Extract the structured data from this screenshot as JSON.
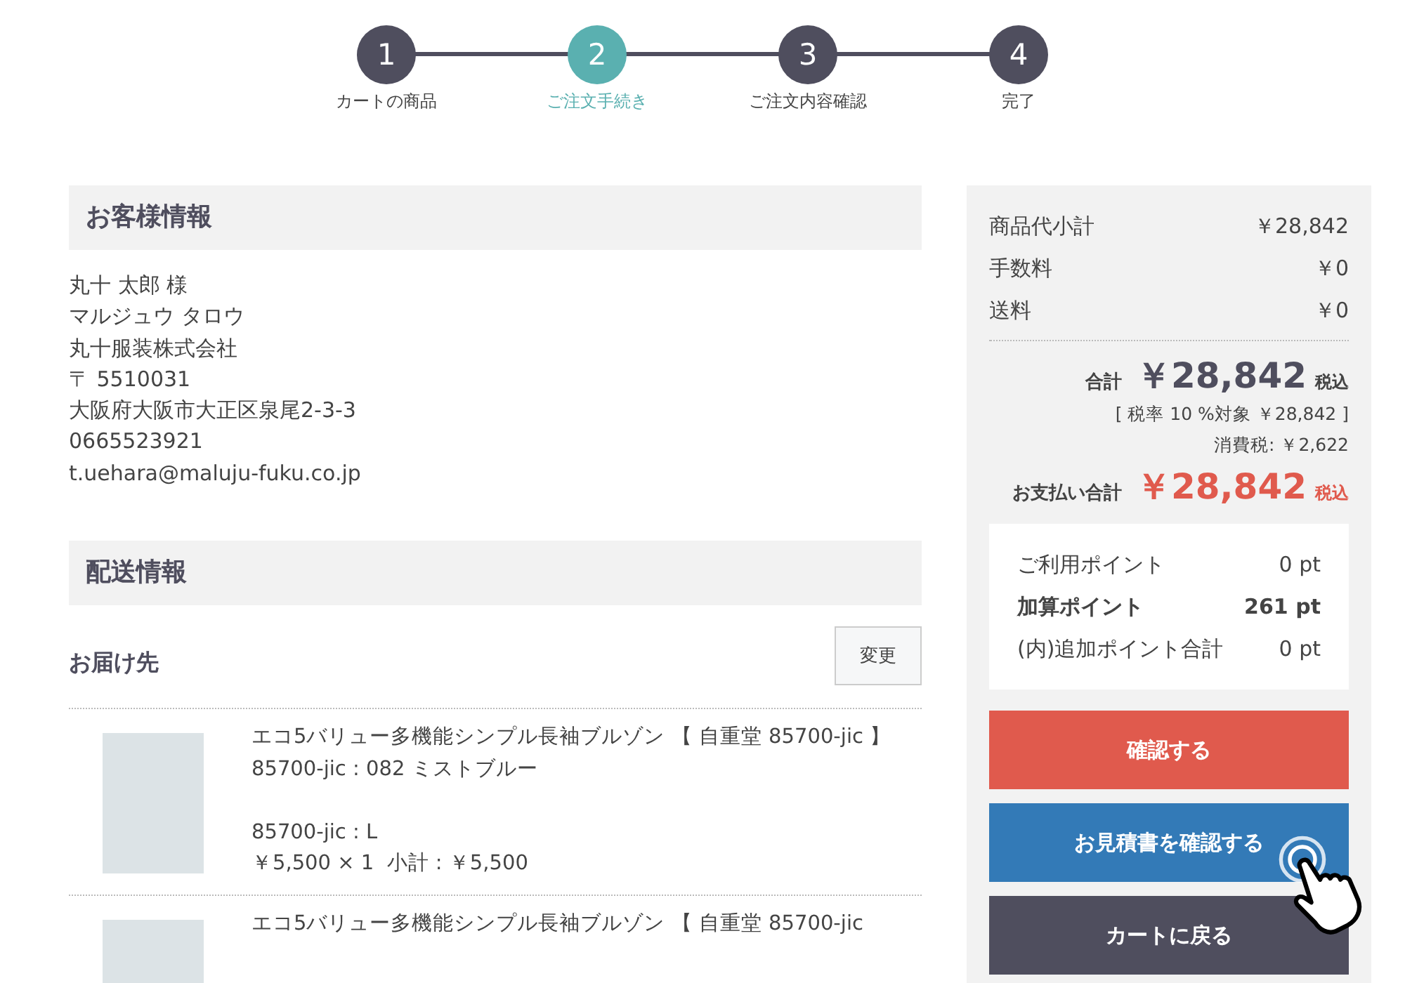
{
  "steps": [
    {
      "number": "1",
      "label": "カートの商品",
      "selected": false
    },
    {
      "number": "2",
      "label": "ご注文手続き",
      "selected": true
    },
    {
      "number": "3",
      "label": "ご注文内容確認",
      "selected": false
    },
    {
      "number": "4",
      "label": "完了",
      "selected": false
    }
  ],
  "customer": {
    "heading": "お客様情報",
    "lines": [
      "丸十 太郎 様",
      "マルジュウ タロウ",
      "丸十服装株式会社",
      "〒 5510031",
      "大阪府大阪市大正区泉尾2-3-3",
      "0665523921",
      "t.uehara@maluju-fuku.co.jp"
    ]
  },
  "shipping": {
    "heading": "配送情報",
    "destination_label": "お届け先",
    "change_button": "変更",
    "items": [
      {
        "title": "エコ5バリュー多機能シンプル長袖ブルゾン 【 自重堂 85700-jic 】",
        "option_line": "85700-jic : 082 ミストブルー",
        "size_line": "85700-jic : L",
        "price_line": "￥5,500 × 1  小計 : ￥5,500"
      },
      {
        "title": "エコ5バリュー多機能シンプル長袖ブルゾン 【 自重堂 85700-jic"
      }
    ]
  },
  "summary": {
    "rows": [
      {
        "label": "商品代小計",
        "value": "￥28,842"
      },
      {
        "label": "手数料",
        "value": "￥0"
      },
      {
        "label": "送料",
        "value": "￥0"
      }
    ],
    "total": {
      "label": "合計",
      "amount": "￥28,842",
      "tax_note": "税込"
    },
    "tax_rate_line": "[ 税率 10 %対象 ￥28,842 ]",
    "consumption_tax": "消費税: ￥2,622",
    "payment": {
      "label": "お支払い合計",
      "amount": "￥28,842",
      "tax_note": "税込"
    },
    "points": [
      {
        "label": "ご利用ポイント",
        "value": "0 pt",
        "emphasized": false
      },
      {
        "label": "加算ポイント",
        "value": "261 pt",
        "emphasized": true
      },
      {
        "label": "(内)追加ポイント合計",
        "value": "0 pt",
        "emphasized": false
      }
    ],
    "buttons": [
      {
        "label": "確認する",
        "kind": "confirm"
      },
      {
        "label": "お見積書を確認する",
        "kind": "estimate"
      },
      {
        "label": "カートに戻る",
        "kind": "back"
      }
    ]
  }
}
